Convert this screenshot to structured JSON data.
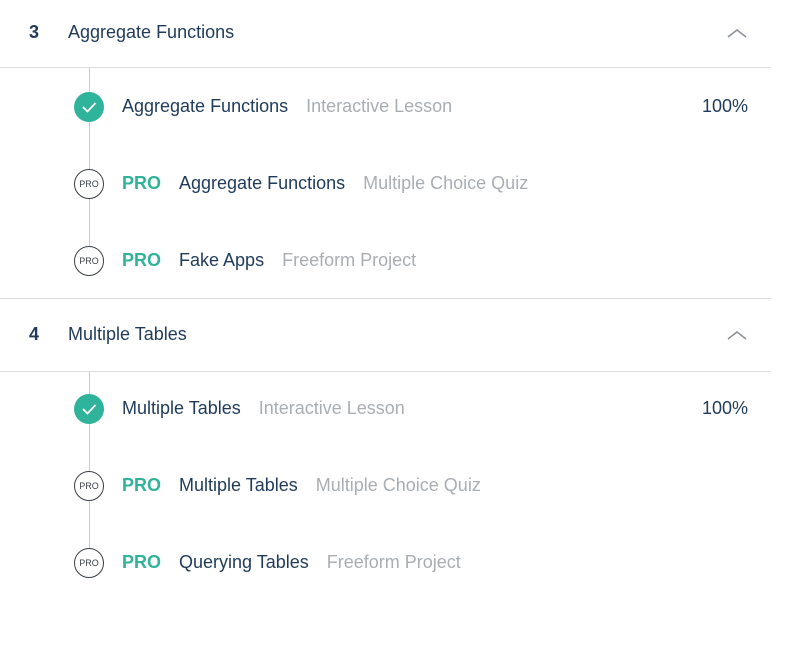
{
  "sections": [
    {
      "number": "3",
      "title": "Aggregate Functions",
      "items": [
        {
          "status": "done",
          "pro": "",
          "node_label": "",
          "title": "Aggregate Functions",
          "type": "Interactive Lesson",
          "progress": "100%"
        },
        {
          "status": "pro",
          "pro": "PRO",
          "node_label": "PRO",
          "title": "Aggregate Functions",
          "type": "Multiple Choice Quiz",
          "progress": ""
        },
        {
          "status": "pro",
          "pro": "PRO",
          "node_label": "PRO",
          "title": "Fake Apps",
          "type": "Freeform Project",
          "progress": ""
        }
      ]
    },
    {
      "number": "4",
      "title": "Multiple Tables",
      "items": [
        {
          "status": "done",
          "pro": "",
          "node_label": "",
          "title": "Multiple Tables",
          "type": "Interactive Lesson",
          "progress": "100%"
        },
        {
          "status": "pro",
          "pro": "PRO",
          "node_label": "PRO",
          "title": "Multiple Tables",
          "type": "Multiple Choice Quiz",
          "progress": ""
        },
        {
          "status": "pro",
          "pro": "PRO",
          "node_label": "PRO",
          "title": "Querying Tables",
          "type": "Freeform Project",
          "progress": ""
        }
      ]
    }
  ],
  "colors": {
    "accent": "#2fb39b",
    "text": "#1f3a5a",
    "muted": "#a9aeb3",
    "divider": "#dcdfe2"
  },
  "icons": {
    "collapse": "chevron-up-icon",
    "complete": "checkmark-icon"
  }
}
